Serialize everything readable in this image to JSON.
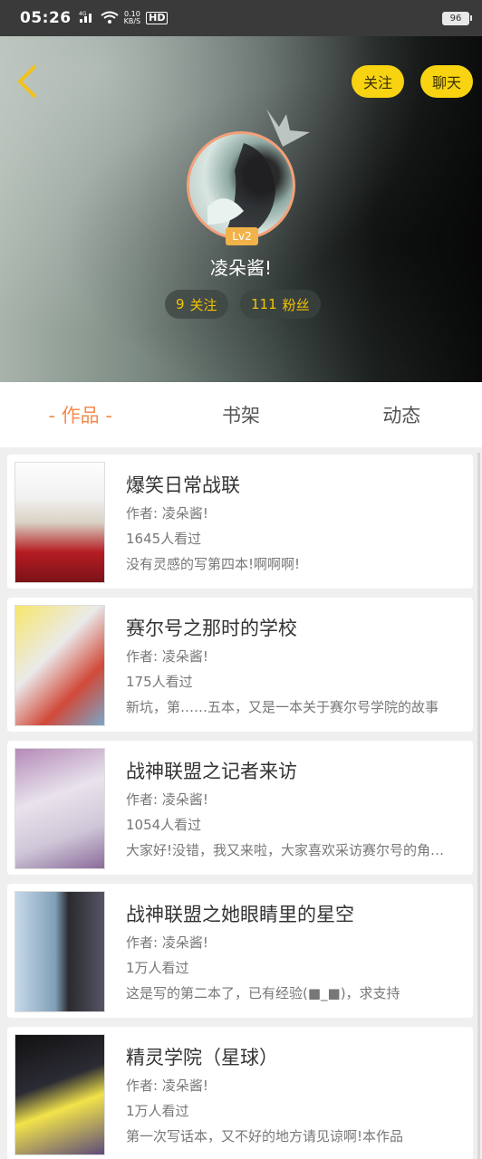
{
  "status_bar": {
    "time": "05:26",
    "network": "4G",
    "speed_value": "0.10",
    "speed_unit": "KB/S",
    "hd": "HD",
    "battery": "96"
  },
  "header": {
    "follow_label": "关注",
    "chat_label": "聊天",
    "level": "Lv2",
    "username": "凌朵酱!",
    "following_count": "9",
    "following_label": "关注",
    "fans_count": "111",
    "fans_label": "粉丝"
  },
  "tabs": [
    {
      "label": "- 作品 -",
      "active": true
    },
    {
      "label": "书架",
      "active": false
    },
    {
      "label": "动态",
      "active": false
    }
  ],
  "works": [
    {
      "title": "爆笑日常战联",
      "author": "作者: 凌朵酱!",
      "views": "1645人看过",
      "desc": "没有灵感的写第四本!啊啊啊!"
    },
    {
      "title": "赛尔号之那时的学校",
      "author": "作者: 凌朵酱!",
      "views": "175人看过",
      "desc": "新坑，第……五本，又是一本关于赛尔号学院的故事"
    },
    {
      "title": "战神联盟之记者来访",
      "author": "作者: 凌朵酱!",
      "views": "1054人看过",
      "desc": "大家好!没错，我又来啦，大家喜欢采访赛尔号的角色吗"
    },
    {
      "title": "战神联盟之她眼睛里的星空",
      "author": "作者: 凌朵酱!",
      "views": "1万人看过",
      "desc": "这是写的第二本了，已有经验(■_■)，求支持"
    },
    {
      "title": "精灵学院（星球）",
      "author": "作者: 凌朵酱!",
      "views": "1万人看过",
      "desc": "第一次写话本，又不好的地方请见谅啊!本作品"
    }
  ],
  "colors": {
    "accent_yellow": "#f7d312",
    "tab_active": "#f48b4f",
    "avatar_ring": "#f3a07a",
    "level_badge": "#f2b24a"
  }
}
